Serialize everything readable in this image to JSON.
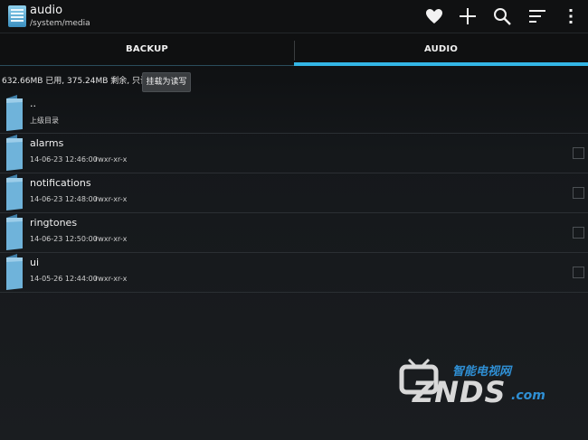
{
  "actionbar": {
    "title": "audio",
    "subtitle": "/system/media",
    "icons": [
      "heart-icon",
      "add-icon",
      "search-icon",
      "sort-icon",
      "overflow-menu-icon"
    ]
  },
  "tabs": [
    {
      "label": "BACKUP",
      "selected": false
    },
    {
      "label": "AUDIO",
      "selected": true
    }
  ],
  "storage": {
    "info": "632.66MB 已用, 375.24MB 剩余, 只读",
    "mount_button": "挂载为读写"
  },
  "rows": [
    {
      "name": "..",
      "meta": "上级目录",
      "perm": ""
    },
    {
      "name": "alarms",
      "meta": "14-06-23 12:46:00",
      "perm": "rwxr-xr-x"
    },
    {
      "name": "notifications",
      "meta": "14-06-23 12:48:00",
      "perm": "rwxr-xr-x"
    },
    {
      "name": "ringtones",
      "meta": "14-06-23 12:50:00",
      "perm": "rwxr-xr-x"
    },
    {
      "name": "ui",
      "meta": "14-05-26 12:44:00",
      "perm": "rwxr-xr-x"
    }
  ],
  "watermark": {
    "top": "智能电视网",
    "main": "ZNDS",
    "com": ".com"
  },
  "colors": {
    "accent": "#33b5e5",
    "folder": "#5fa6cf"
  }
}
